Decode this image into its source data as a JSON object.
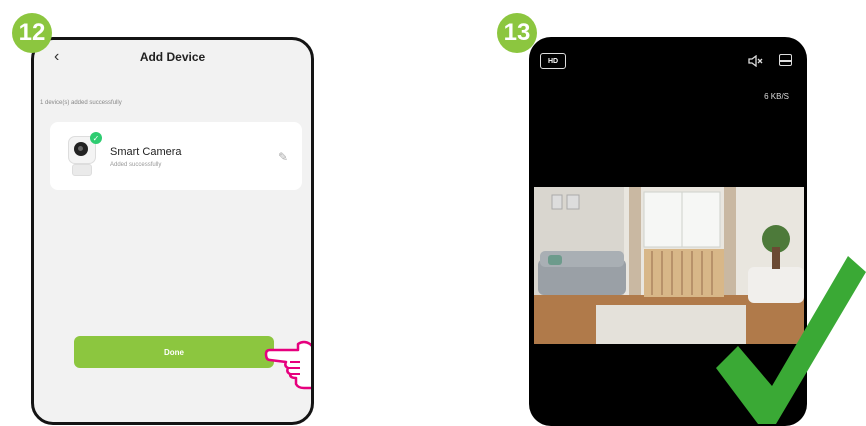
{
  "step12": {
    "badge": "12",
    "header": {
      "back_icon": "back-arrow-icon",
      "title": "Add Device"
    },
    "status_text": "1 device(s) added successfully",
    "device": {
      "name": "Smart Camera",
      "status": "Added successfully",
      "badge_icon": "check-icon",
      "edit_icon": "edit-pencil-icon"
    },
    "done_label": "Done",
    "accent": "#8cc63f"
  },
  "step13": {
    "badge": "13",
    "hd_label": "HD",
    "rate": "6 KB/S",
    "icons": [
      "mute-icon",
      "layout-icon"
    ],
    "feed_description_icon": "camera-feed-image",
    "confirm_icon": "checkmark-icon",
    "confirm_color": "#3aa935"
  }
}
